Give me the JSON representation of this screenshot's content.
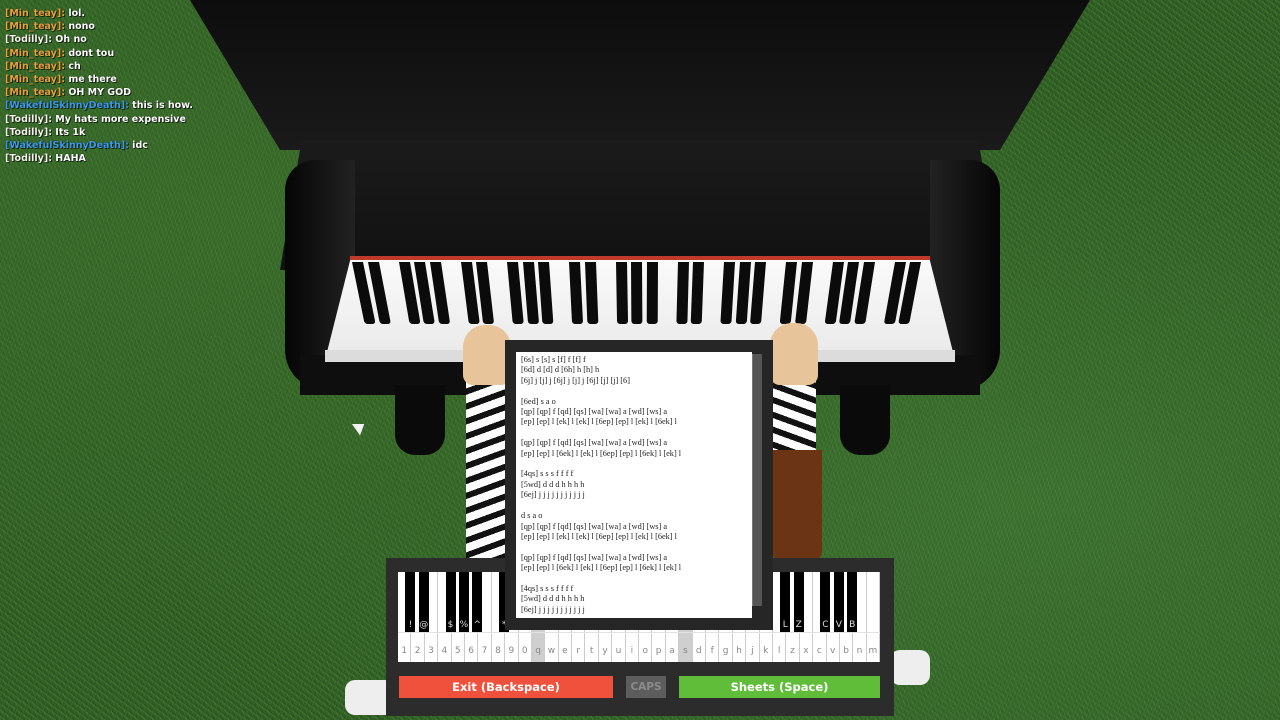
{
  "chat": {
    "colors": {
      "orange": "#e8a33b",
      "blue": "#3d9ae8",
      "white": "#f3f3e8"
    },
    "messages": [
      {
        "user": "[Min_teay]:",
        "text": "lol.",
        "color": "#e8a33b"
      },
      {
        "user": "[Min_teay]:",
        "text": "nono",
        "color": "#e8a33b"
      },
      {
        "user": "[Todilly]:",
        "text": "Oh no",
        "color": "#f3f3e8"
      },
      {
        "user": "[Min_teay]:",
        "text": "dont tou",
        "color": "#e8a33b"
      },
      {
        "user": "[Min_teay]:",
        "text": "ch",
        "color": "#e8a33b"
      },
      {
        "user": "[Min_teay]:",
        "text": "me there",
        "color": "#e8a33b"
      },
      {
        "user": "[Min_teay]:",
        "text": "OH MY GOD",
        "color": "#e8a33b"
      },
      {
        "user": "[WakefulSkinnyDeath]:",
        "text": "this is how.",
        "color": "#3d9ae8"
      },
      {
        "user": "[Todilly]:",
        "text": "My hats more expensive",
        "color": "#f3f3e8"
      },
      {
        "user": "[Todilly]:",
        "text": "Its 1k",
        "color": "#f3f3e8"
      },
      {
        "user": "[WakefulSkinnyDeath]:",
        "text": "idc",
        "color": "#3d9ae8"
      },
      {
        "user": "[Todilly]:",
        "text": "HAHA",
        "color": "#f3f3e8"
      }
    ]
  },
  "sheet": {
    "lines": [
      "[6s] s [s] s [f] f [f] f",
      "[6d] d [d] d [6h] h [h] h",
      "[6j] j [j] j [6j] j [j] j [6j] [j] [j] [6]",
      "",
      "[6ed] s a o",
      "[qp] [qp] f [qd] [qs] [wa] [wa] a [wd] [ws] a",
      "[ep] [ep] l [ek] l [ek] l [6ep] [ep] l [ek] l [6ek] l",
      "",
      "[qp] [qp] f [qd] [qs] [wa] [wa] a [wd] [ws] a",
      "[ep] [ep] l [6ek] l [ek] l [6ep] [ep] l [6ek] l [ek] l",
      "",
      "[4qs] s s s f f f f",
      "[5wd] d d d h h h h",
      "[6ej] j j j j j j j j j j j",
      "",
      "d s a o",
      "[qp] [qp] f [qd] [qs] [wa] [wa] a [wd] [ws] a",
      "[ep] [ep] l [ek] l [ek] l [6ep] [ep] l [ek] l [6ek] l",
      "",
      "[qp] [qp] f [qd] [qs] [wa] [wa] a [wd] [ws] a",
      "[ep] [ep] l [6ek] l [ek] l [6ep] [ep] l [6ek] l [ek] l",
      "",
      "[4qs] s s s f f f f",
      "[5wd] d d d h h h h",
      "[6ej] j j j j j j j j j j j"
    ]
  },
  "keyboard": {
    "white_keys": [
      "1",
      "2",
      "3",
      "4",
      "5",
      "6",
      "7",
      "8",
      "9",
      "0",
      "q",
      "w",
      "e",
      "r",
      "t",
      "y",
      "u",
      "i",
      "o",
      "p",
      "a",
      "s",
      "d",
      "f",
      "g",
      "h",
      "j",
      "k",
      "l",
      "z",
      "x",
      "c",
      "v",
      "b",
      "n",
      "m"
    ],
    "pressed_keys": [
      "q",
      "s"
    ],
    "black_keys_visible": [
      {
        "label": "!",
        "after": "1"
      },
      {
        "label": "@",
        "after": "2"
      },
      {
        "label": "$",
        "after": "4"
      },
      {
        "label": "%",
        "after": "5"
      },
      {
        "label": "^",
        "after": "6"
      },
      {
        "label": "*",
        "after": "8"
      },
      {
        "label": "L",
        "after": "l"
      },
      {
        "label": "Z",
        "after": "z"
      },
      {
        "label": "C",
        "after": "c"
      },
      {
        "label": "V",
        "after": "v"
      },
      {
        "label": "B",
        "after": "b"
      }
    ]
  },
  "buttons": {
    "exit_label": "Exit (Backspace)",
    "caps_label": "CAPS",
    "sheets_label": "Sheets (Space)"
  }
}
